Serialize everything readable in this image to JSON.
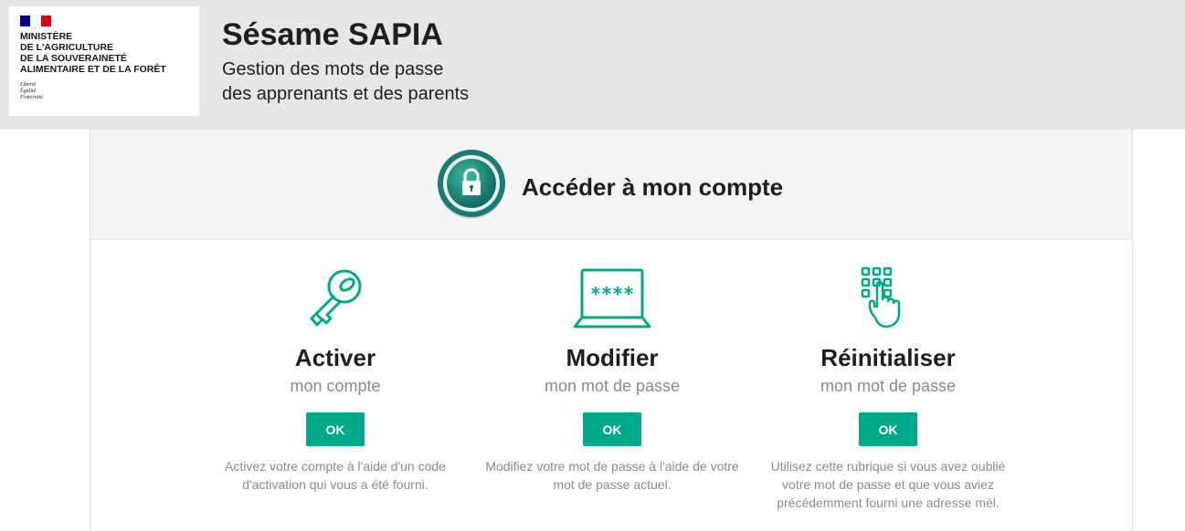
{
  "colors": {
    "accent": "#00a88a",
    "header_bg": "#e6e6e6",
    "flag_blue": "#000091",
    "flag_white": "#ffffff",
    "flag_red": "#e1000f"
  },
  "logo": {
    "ministry": "MINISTÈRE\nDE L'AGRICULTURE\nDE LA SOUVERAINETÉ\nALIMENTAIRE ET DE LA FORÊT",
    "motto": "Liberté\nÉgalité\nFraternité"
  },
  "header": {
    "title": "Sésame SAPIA",
    "subtitle": "Gestion des mots de passe\ndes apprenants et des parents"
  },
  "card": {
    "title": "Accéder à mon compte",
    "icon": "padlock-icon"
  },
  "options": [
    {
      "icon": "key-icon",
      "title": "Activer",
      "subtitle": "mon compte",
      "button": "OK",
      "description": "Activez votre compte à l'aide d'un code d'activation qui vous a été fourni."
    },
    {
      "icon": "laptop-password-icon",
      "title": "Modifier",
      "subtitle": "mon mot de passe",
      "button": "OK",
      "description": "Modifiez votre mot de passe à l'aide de votre mot de passe actuel."
    },
    {
      "icon": "keypad-touch-icon",
      "title": "Réinitialiser",
      "subtitle": "mon mot de passe",
      "button": "OK",
      "description": "Utilisez cette rubrique si vous avez oublié votre mot de passe et que vous aviez précédemment fourni une adresse mél."
    }
  ]
}
